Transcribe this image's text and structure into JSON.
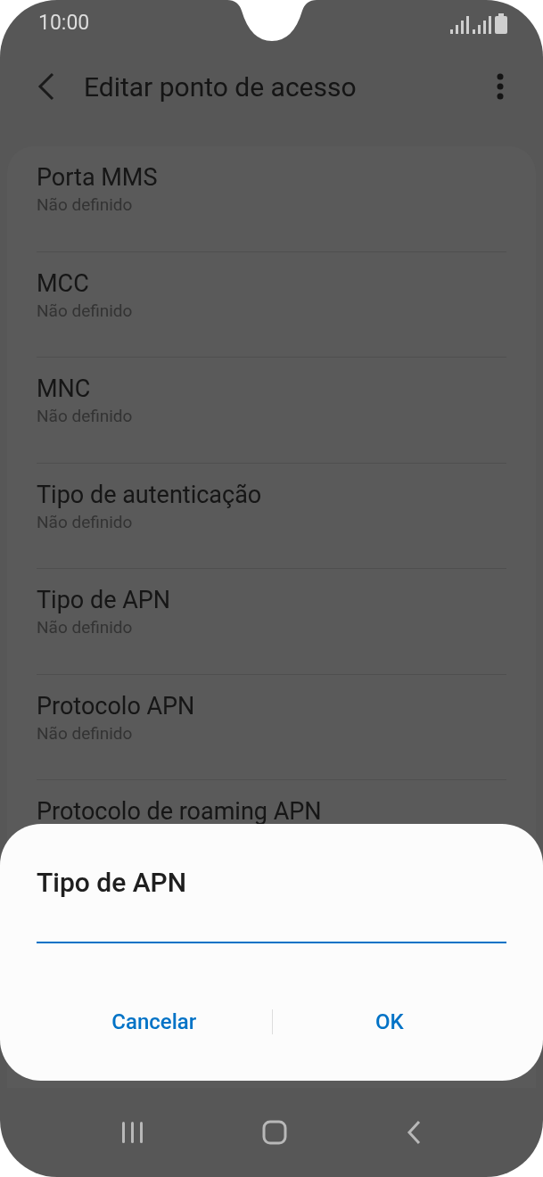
{
  "status_bar": {
    "time": "10:00"
  },
  "header": {
    "title": "Editar ponto de acesso"
  },
  "settings": [
    {
      "title": "Porta MMS",
      "value": "Não definido"
    },
    {
      "title": "MCC",
      "value": "Não definido"
    },
    {
      "title": "MNC",
      "value": "Não definido"
    },
    {
      "title": "Tipo de autenticação",
      "value": "Não definido"
    },
    {
      "title": "Tipo de APN",
      "value": "Não definido"
    },
    {
      "title": "Protocolo APN",
      "value": "Não definido"
    },
    {
      "title": "Protocolo de roaming APN"
    }
  ],
  "dialog": {
    "title": "Tipo de APN",
    "buttons": [
      "Cancelar",
      "OK"
    ]
  }
}
